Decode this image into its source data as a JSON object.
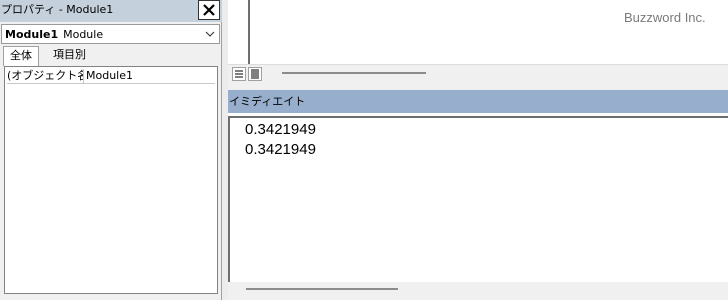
{
  "properties_window": {
    "title": "プロパティ - Module1",
    "close_icon": "close-icon",
    "object_select": {
      "name": "Module1",
      "type": "Module"
    },
    "tabs": [
      {
        "label": "全体",
        "active": true
      },
      {
        "label": "項目別",
        "active": false
      }
    ],
    "rows": [
      {
        "name": "(オブジェクト名)",
        "value": "Module1"
      }
    ]
  },
  "code_window": {
    "watermark": "Buzzword Inc.",
    "view_buttons": [
      "procedure-view-icon",
      "full-module-view-icon"
    ]
  },
  "immediate_window": {
    "title": "イミディエイト",
    "lines": [
      "0.3421949",
      "0.3421949"
    ]
  },
  "colors": {
    "properties_titlebar": "#c4d0dc",
    "immediate_titlebar": "#97afcd",
    "panel_background": "#f0f0f0"
  }
}
